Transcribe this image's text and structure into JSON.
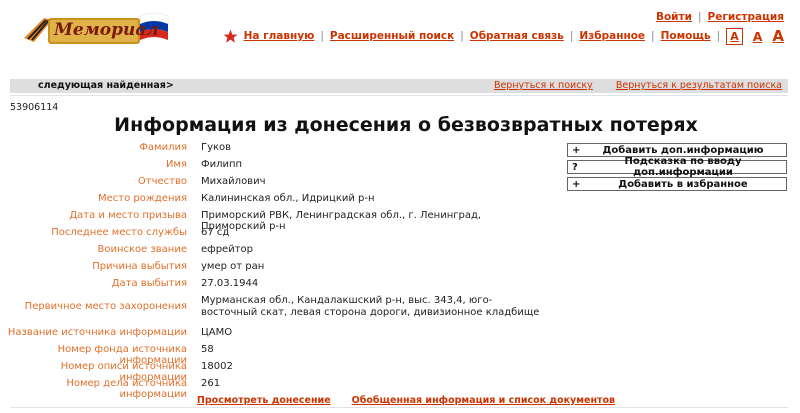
{
  "header": {
    "logo_text": "Мемориал",
    "auth": {
      "login": "Войти",
      "register": "Регистрация"
    },
    "nav": [
      "На главную",
      "Расширенный поиск",
      "Обратная связь",
      "Избранное",
      "Помощь"
    ],
    "font_sizes": [
      "A",
      "A",
      "A"
    ]
  },
  "strip": {
    "next": "следующая найденная",
    "back_search": "Вернуться к поиску",
    "back_results": "Вернуться к результатам поиска"
  },
  "record_id": "53906114",
  "title": "Информация из донесения о безвозвратных потерях",
  "fields": [
    {
      "label": "Фамилия",
      "value": "Гуков"
    },
    {
      "label": "Имя",
      "value": "Филипп"
    },
    {
      "label": "Отчество",
      "value": "Михайлович"
    },
    {
      "label": "Место рождения",
      "value": "Калининская обл., Идрицкий р-н"
    },
    {
      "label": "Дата и место призыва",
      "value": "Приморский РВК, Ленинградская обл., г. Ленинград, Приморский р-н"
    },
    {
      "label": "Последнее место службы",
      "value": "67 сд"
    },
    {
      "label": "Воинское звание",
      "value": "ефрейтор"
    },
    {
      "label": "Причина выбытия",
      "value": "умер от ран"
    },
    {
      "label": "Дата выбытия",
      "value": "27.03.1944"
    },
    {
      "label": "Первичное место захоронения",
      "value": "Мурманская обл., Кандалакшский р-н, выс. 343,4, юго-восточный скат, левая сторона дороги, дивизионное кладбище"
    },
    {
      "label": "Название источника информации",
      "value": "ЦАМО"
    },
    {
      "label": "Номер фонда источника информации",
      "value": "58"
    },
    {
      "label": "Номер описи источника информации",
      "value": "18002"
    },
    {
      "label": "Номер дела источника информации",
      "value": "261"
    }
  ],
  "buttons": [
    {
      "icon": "+",
      "label": "Добавить доп.информацию"
    },
    {
      "icon": "?",
      "label": "Подсказка по вводу доп.информации"
    },
    {
      "icon": "+",
      "label": "Добавить в избранное"
    }
  ],
  "bottom": {
    "view_report": "Просмотреть донесение",
    "summary": "Обобщенная информация и список документов"
  },
  "colors": {
    "link": "#cc3300",
    "label": "#e0702a",
    "strip": "#dedede",
    "flag_red": "#d52b1e",
    "flag_blue": "#0039a6"
  }
}
